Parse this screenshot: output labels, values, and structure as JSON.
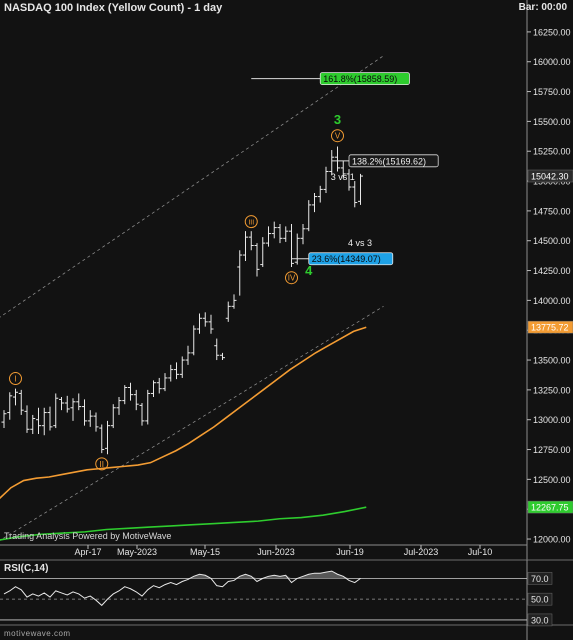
{
  "header": {
    "title": "NASDAQ 100 Index (Yellow Count) - 1 day",
    "bar_info": "Bar: 00:00"
  },
  "footer": {
    "credit": "Trading Analysis Powered by MotiveWave",
    "watermark": "motivewave.com"
  },
  "chart_data": [
    {
      "type": "candlestick",
      "title": "NASDAQ 100 Index (Yellow Count) - 1 day",
      "ylim": [
        11950,
        16400
      ],
      "y_ticks": [
        12000,
        12250,
        12500,
        12750,
        13000,
        13250,
        13500,
        13750,
        14000,
        14250,
        14500,
        14750,
        15000,
        15250,
        15500,
        15750,
        16000,
        16250
      ],
      "x_ticks": [
        "Apr-17",
        "May-2023",
        "May-15",
        "Jun-2023",
        "Jun-19",
        "Jul-2023",
        "Jul-10"
      ],
      "price_axis_labels": [
        {
          "text": "15042.30",
          "value": 15042.3,
          "color": "#2c2c2c"
        },
        {
          "text": "13775.72",
          "value": 13775.72,
          "color": "#f39c33"
        },
        {
          "text": "12267.75",
          "value": 12267.75,
          "color": "#2ecc2e"
        }
      ],
      "bars": [
        {
          "o": 12980,
          "h": 13080,
          "l": 12930,
          "c": 13050
        },
        {
          "o": 13060,
          "h": 13230,
          "l": 13000,
          "c": 13200
        },
        {
          "o": 13190,
          "h": 13260,
          "l": 13120,
          "c": 13230
        },
        {
          "o": 13220,
          "h": 13250,
          "l": 13040,
          "c": 13080
        },
        {
          "o": 13070,
          "h": 13120,
          "l": 12890,
          "c": 12920
        },
        {
          "o": 12920,
          "h": 13040,
          "l": 12880,
          "c": 13010
        },
        {
          "o": 13000,
          "h": 13100,
          "l": 12880,
          "c": 12950
        },
        {
          "o": 12950,
          "h": 13100,
          "l": 12870,
          "c": 13060
        },
        {
          "o": 13060,
          "h": 13110,
          "l": 12910,
          "c": 12940
        },
        {
          "o": 12950,
          "h": 13220,
          "l": 12930,
          "c": 13180
        },
        {
          "o": 13170,
          "h": 13190,
          "l": 13080,
          "c": 13140
        },
        {
          "o": 13140,
          "h": 13200,
          "l": 13060,
          "c": 13090
        },
        {
          "o": 13100,
          "h": 13180,
          "l": 12990,
          "c": 13150
        },
        {
          "o": 13150,
          "h": 13220,
          "l": 13080,
          "c": 13110
        },
        {
          "o": 13110,
          "h": 13170,
          "l": 12950,
          "c": 12990
        },
        {
          "o": 12990,
          "h": 13080,
          "l": 12940,
          "c": 13030
        },
        {
          "o": 13030,
          "h": 13060,
          "l": 12900,
          "c": 12940
        },
        {
          "o": 12930,
          "h": 12960,
          "l": 12720,
          "c": 12750
        },
        {
          "o": 12760,
          "h": 12990,
          "l": 12710,
          "c": 12950
        },
        {
          "o": 12950,
          "h": 13130,
          "l": 12930,
          "c": 13100
        },
        {
          "o": 13100,
          "h": 13190,
          "l": 13040,
          "c": 13160
        },
        {
          "o": 13160,
          "h": 13290,
          "l": 13130,
          "c": 13270
        },
        {
          "o": 13270,
          "h": 13310,
          "l": 13160,
          "c": 13210
        },
        {
          "o": 13210,
          "h": 13250,
          "l": 13080,
          "c": 13130
        },
        {
          "o": 13120,
          "h": 13140,
          "l": 12950,
          "c": 12990
        },
        {
          "o": 12990,
          "h": 13250,
          "l": 12960,
          "c": 13220
        },
        {
          "o": 13220,
          "h": 13330,
          "l": 13190,
          "c": 13310
        },
        {
          "o": 13310,
          "h": 13350,
          "l": 13220,
          "c": 13260
        },
        {
          "o": 13260,
          "h": 13390,
          "l": 13240,
          "c": 13350
        },
        {
          "o": 13350,
          "h": 13460,
          "l": 13320,
          "c": 13420
        },
        {
          "o": 13420,
          "h": 13480,
          "l": 13340,
          "c": 13380
        },
        {
          "o": 13380,
          "h": 13530,
          "l": 13350,
          "c": 13500
        },
        {
          "o": 13500,
          "h": 13620,
          "l": 13460,
          "c": 13560
        },
        {
          "o": 13560,
          "h": 13790,
          "l": 13540,
          "c": 13760
        },
        {
          "o": 13760,
          "h": 13890,
          "l": 13720,
          "c": 13850
        },
        {
          "o": 13850,
          "h": 13900,
          "l": 13780,
          "c": 13820
        },
        {
          "o": 13820,
          "h": 13880,
          "l": 13720,
          "c": 13760
        },
        {
          "o": 13620,
          "h": 13680,
          "l": 13500,
          "c": 13540
        },
        {
          "o": 13540,
          "h": 13560,
          "l": 13500,
          "c": 13520
        },
        {
          "o": 13850,
          "h": 13990,
          "l": 13820,
          "c": 13950
        },
        {
          "o": 13950,
          "h": 14050,
          "l": 13930,
          "c": 14000
        },
        {
          "o": 14280,
          "h": 14420,
          "l": 14040,
          "c": 14380
        },
        {
          "o": 14380,
          "h": 14580,
          "l": 14330,
          "c": 14530
        },
        {
          "o": 14530,
          "h": 14580,
          "l": 14420,
          "c": 14460
        },
        {
          "o": 14460,
          "h": 14480,
          "l": 14200,
          "c": 14260
        },
        {
          "o": 14300,
          "h": 14530,
          "l": 14280,
          "c": 14480
        },
        {
          "o": 14480,
          "h": 14620,
          "l": 14450,
          "c": 14560
        },
        {
          "o": 14560,
          "h": 14660,
          "l": 14520,
          "c": 14610
        },
        {
          "o": 14610,
          "h": 14640,
          "l": 14480,
          "c": 14520
        },
        {
          "o": 14520,
          "h": 14620,
          "l": 14490,
          "c": 14580
        },
        {
          "o": 14580,
          "h": 14640,
          "l": 14280,
          "c": 14310
        },
        {
          "o": 14320,
          "h": 14560,
          "l": 14300,
          "c": 14520
        },
        {
          "o": 14520,
          "h": 14640,
          "l": 14470,
          "c": 14600
        },
        {
          "o": 14600,
          "h": 14840,
          "l": 14580,
          "c": 14800
        },
        {
          "o": 14800,
          "h": 14900,
          "l": 14740,
          "c": 14870
        },
        {
          "o": 14870,
          "h": 14960,
          "l": 14820,
          "c": 14930
        },
        {
          "o": 14930,
          "h": 15120,
          "l": 14900,
          "c": 15080
        },
        {
          "o": 15080,
          "h": 15260,
          "l": 15050,
          "c": 15200
        },
        {
          "o": 15200,
          "h": 15290,
          "l": 15080,
          "c": 15110
        },
        {
          "o": 15110,
          "h": 15170,
          "l": 15020,
          "c": 15060
        },
        {
          "o": 15060,
          "h": 15100,
          "l": 14920,
          "c": 14950
        },
        {
          "o": 14950,
          "h": 15000,
          "l": 14780,
          "c": 14820
        },
        {
          "o": 14830,
          "h": 15060,
          "l": 14800,
          "c": 15042
        }
      ],
      "moving_averages": [
        {
          "color": "#f39c33",
          "start_bar": -1,
          "values": [
            12330,
            12430,
            12490,
            12510,
            12520,
            12540,
            12560,
            12580,
            12590,
            12600,
            12610,
            12620,
            12640,
            12690,
            12740,
            12800,
            12870,
            12940,
            13020,
            13100,
            13180,
            13260,
            13340,
            13420,
            13490,
            13560,
            13620,
            13680,
            13740,
            13775
          ]
        },
        {
          "color": "#2ecc2e",
          "start_bar": -1,
          "values": [
            11990,
            12020,
            12040,
            12050,
            12060,
            12080,
            12090,
            12100,
            12110,
            12120,
            12130,
            12140,
            12150,
            12170,
            12180,
            12200,
            12230,
            12267
          ]
        }
      ],
      "channel_lines": [
        {
          "x0": -1,
          "y0": 13850,
          "x1": 66,
          "y1": 16050,
          "style": "dashed"
        },
        {
          "x0": -1,
          "y0": 11980,
          "x1": 66,
          "y1": 13950,
          "style": "dashed"
        }
      ],
      "fib_levels": [
        {
          "label": "161.8%(15858.59)",
          "value": 15858.59,
          "bar_start": 43,
          "bar_end": 55,
          "color": "#2ecc2e"
        },
        {
          "label": "138.2%(15169.62)",
          "value": 15169.62,
          "bar_start": 57,
          "bar_end": 60,
          "color": "#f0f0f0"
        },
        {
          "label": "23.6%(14349.07)",
          "value": 14349.07,
          "bar_start": 50,
          "bar_end": 53,
          "color": "#1ea1e6"
        }
      ],
      "wave_labels": [
        {
          "text": "I",
          "bar": 2,
          "value": 13345,
          "style": "circle"
        },
        {
          "text": "II",
          "bar": 17,
          "value": 12630,
          "style": "circle"
        },
        {
          "text": "III",
          "bar": 43,
          "value": 14660,
          "style": "circle"
        },
        {
          "text": "IV",
          "bar": 50,
          "value": 14190,
          "style": "circle"
        },
        {
          "text": "V",
          "bar": 58,
          "value": 15380,
          "style": "circle"
        },
        {
          "text": "3",
          "bar": 58,
          "value": 15510,
          "style": "green"
        },
        {
          "text": "4",
          "bar": 53,
          "value": 14245,
          "style": "green"
        }
      ],
      "annotations": [
        {
          "text": "3 vs 1",
          "bar": 61,
          "value": 15010
        },
        {
          "text": "4 vs 3",
          "bar": 64,
          "value": 14455
        }
      ]
    },
    {
      "type": "line",
      "title": "RSI(C,14)",
      "ylim": [
        28,
        80
      ],
      "y_ticks": [
        70.0,
        50.0,
        30.0
      ],
      "values": [
        55,
        58,
        62,
        59,
        52,
        55,
        53,
        56,
        52,
        58,
        56,
        54,
        57,
        55,
        51,
        53,
        49,
        44,
        50,
        55,
        58,
        62,
        60,
        57,
        53,
        59,
        63,
        61,
        64,
        66,
        64,
        67,
        69,
        72,
        74,
        73,
        70,
        63,
        62,
        67,
        68,
        72,
        74,
        72,
        67,
        70,
        72,
        73,
        72,
        73,
        66,
        70,
        72,
        74,
        75,
        75,
        76,
        77,
        74,
        72,
        68,
        66,
        70
      ]
    }
  ]
}
